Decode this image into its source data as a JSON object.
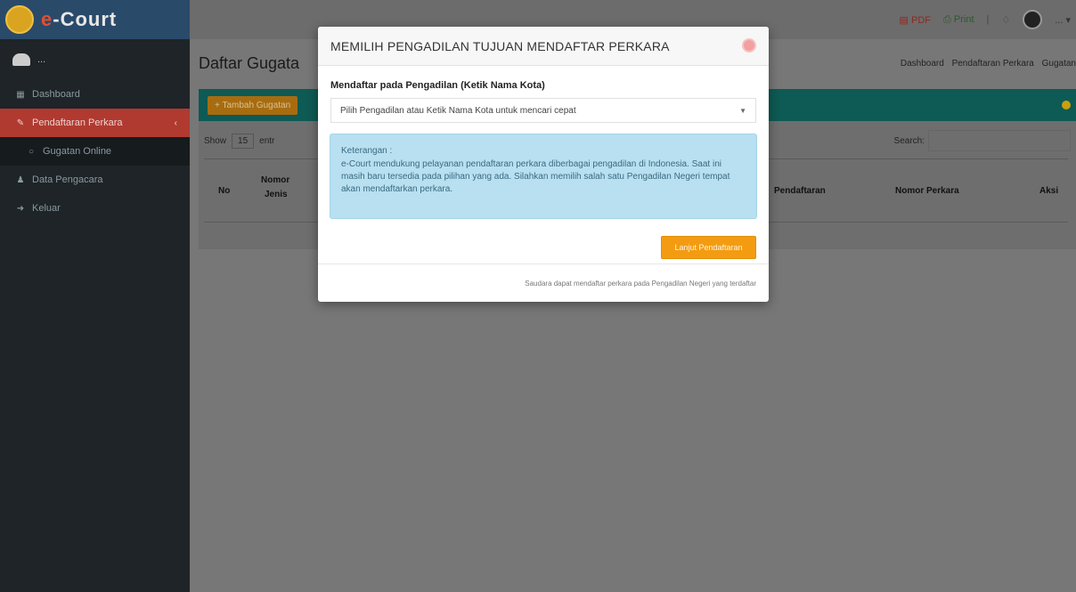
{
  "brand": {
    "logo_e": "e",
    "logo_rest": "-Court"
  },
  "sidebar": {
    "user_name": "... ",
    "items": [
      {
        "label": "Dashboard",
        "icon": "dashboard-icon"
      },
      {
        "label": "Pendaftaran Perkara",
        "icon": "edit-icon",
        "active": true
      },
      {
        "label": "Gugatan Online",
        "icon": "circle-icon",
        "sub": true
      },
      {
        "label": "Data Pengacara",
        "icon": "user-icon"
      },
      {
        "label": "Keluar",
        "icon": "signout-icon"
      }
    ]
  },
  "topbar": {
    "pdf_label": "PDF",
    "print_label": "Print",
    "user_label": "..."
  },
  "content": {
    "page_title": "Daftar Gugata",
    "breadcrumb": [
      "Dashboard",
      "Pendaftaran Perkara",
      "Gugatan"
    ],
    "add_button": "+ Tambah Gugatan",
    "show_label": "Show",
    "show_value": "15",
    "entries_label": "entr",
    "search_label": "Search:",
    "columns": [
      "No",
      "Nomor",
      "Jenis",
      "Pendaftaran",
      "Nomor Perkara",
      "Aksi"
    ]
  },
  "modal": {
    "title": "MEMILIH PENGADILAN TUJUAN MENDAFTAR PERKARA",
    "field_label": "Mendaftar pada Pengadilan (Ketik Nama Kota)",
    "select_placeholder": "Pilih Pengadilan atau Ketik Nama Kota untuk mencari cepat",
    "alert_title": "Keterangan :",
    "alert_text": "e-Court mendukung pelayanan pendaftaran perkara diberbagai pengadilan di Indonesia. Saat ini masih baru tersedia pada pilihan yang ada. Silahkan memilih salah satu Pengadilan Negeri tempat akan mendaftarkan perkara.",
    "continue_button": "Lanjut Pendaftaran",
    "footer_text": "Saudara dapat mendaftar perkara pada Pengadilan Negeri yang terdaftar"
  },
  "colors": {
    "sidebar_bg": "#1e2428",
    "active_menu": "#b03a30",
    "panel_head": "#0e5a54",
    "button_orange": "#f39c12",
    "alert_bg": "#b8e0f0"
  }
}
